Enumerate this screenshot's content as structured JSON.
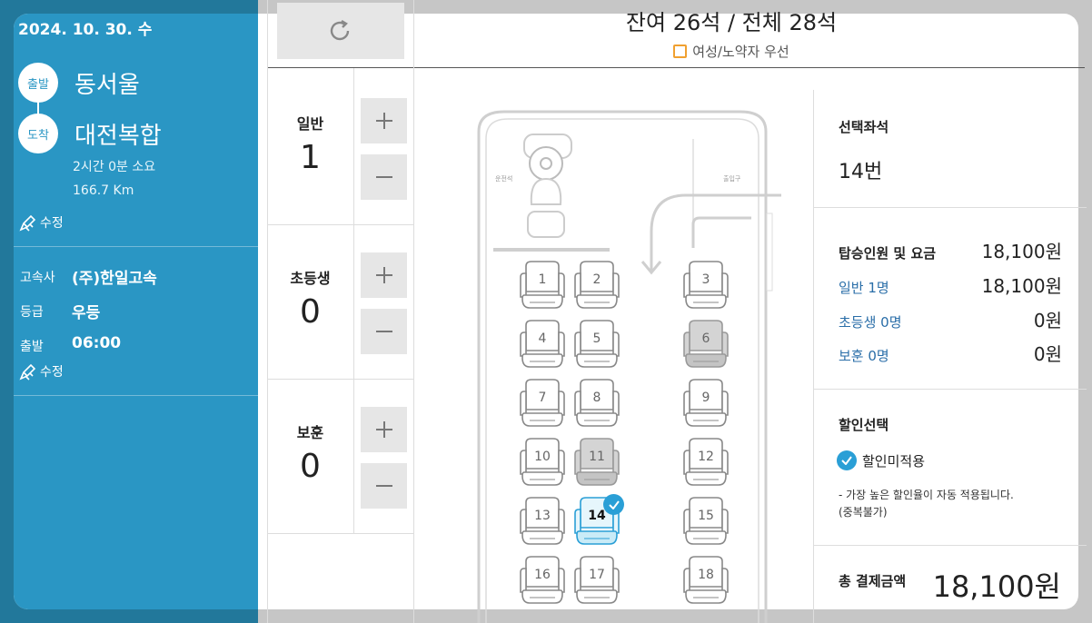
{
  "trip": {
    "date": "2024. 10. 30. 수",
    "depart_badge": "출발",
    "depart_city": "동서울",
    "arrive_badge": "도착",
    "arrive_city": "대전복합",
    "duration": "2시간 0분 소요",
    "distance": "166.7 Km",
    "edit_label": "수정"
  },
  "bus_info": {
    "company_key": "고속사",
    "company_val": "(주)한일고속",
    "grade_key": "등급",
    "grade_val": "우등",
    "depart_key": "출발",
    "depart_val": "06:00",
    "edit_label": "수정"
  },
  "header": {
    "title": "잔여 26석 / 전체 28석",
    "priority_label": "여성/노약자 우선"
  },
  "passengers": [
    {
      "label": "일반",
      "count": "1"
    },
    {
      "label": "초등생",
      "count": "0"
    },
    {
      "label": "보훈",
      "count": "0"
    }
  ],
  "buttons": {
    "plus": "+",
    "minus": "−"
  },
  "seatmap": {
    "driver_label": "운전석",
    "door_label": "출입구",
    "seats": [
      {
        "no": "1",
        "state": "available"
      },
      {
        "no": "2",
        "state": "available"
      },
      {
        "no": "3",
        "state": "available"
      },
      {
        "no": "4",
        "state": "available"
      },
      {
        "no": "5",
        "state": "available"
      },
      {
        "no": "6",
        "state": "sold"
      },
      {
        "no": "7",
        "state": "available"
      },
      {
        "no": "8",
        "state": "available"
      },
      {
        "no": "9",
        "state": "available"
      },
      {
        "no": "10",
        "state": "available"
      },
      {
        "no": "11",
        "state": "sold"
      },
      {
        "no": "12",
        "state": "available"
      },
      {
        "no": "13",
        "state": "available"
      },
      {
        "no": "14",
        "state": "selected"
      },
      {
        "no": "15",
        "state": "available"
      },
      {
        "no": "16",
        "state": "available"
      },
      {
        "no": "17",
        "state": "available"
      },
      {
        "no": "18",
        "state": "available"
      }
    ]
  },
  "summary": {
    "selected_title": "선택좌석",
    "selected_seat": "14번",
    "fare_title": "탑승인원 및 요금",
    "fare_total": "18,100원",
    "rows": [
      {
        "label": "일반 1명",
        "value": "18,100원"
      },
      {
        "label": "초등생 0명",
        "value": "0원"
      },
      {
        "label": "보훈 0명",
        "value": "0원"
      }
    ],
    "discount_title": "할인선택",
    "discount_option": "할인미적용",
    "discount_note_1": "- 가장 높은 할인율이 자동 적용됩니다.",
    "discount_note_2": "(중복불가)",
    "total_title": "총 결제금액",
    "total_value": "18,100원"
  },
  "colors": {
    "accent": "#2a96c4",
    "selected": "#2a9fd6",
    "sold": "#cfcfcf",
    "priority": "#f0a030"
  }
}
